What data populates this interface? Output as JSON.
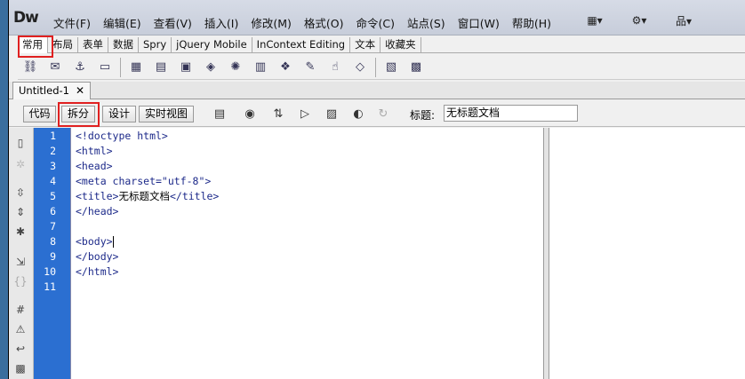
{
  "app": {
    "logo": "Dw"
  },
  "menu": [
    "文件(F)",
    "编辑(E)",
    "查看(V)",
    "插入(I)",
    "修改(M)",
    "格式(O)",
    "命令(C)",
    "站点(S)",
    "窗口(W)",
    "帮助(H)"
  ],
  "toolbar_right": [
    "▦▾",
    "⚙▾",
    "品▾"
  ],
  "insert_tabs": [
    "常用",
    "布局",
    "表单",
    "数据",
    "Spry",
    "jQuery Mobile",
    "InContext Editing",
    "文本",
    "收藏夹"
  ],
  "insert_icons": [
    "hyperlink-icon",
    "email-icon",
    "anchor-icon",
    "horizontal-rule-icon",
    "table-icon",
    "div-icon",
    "image-icon",
    "media-icon",
    "widget-icon",
    "date-icon",
    "server-include-icon",
    "comment-icon",
    "head-icon",
    "script-icon",
    "template-icon",
    "tag-chooser-icon"
  ],
  "document": {
    "tab_name": "Untitled-1",
    "close": "✕"
  },
  "view_bar": {
    "code_label": "代码",
    "split_label": "拆分",
    "design_label": "设计",
    "live_label": "实时视图",
    "title_label": "标题:",
    "title_value": "无标题文档"
  },
  "editor": {
    "line_numbers": [
      "1",
      "2",
      "3",
      "4",
      "5",
      "6",
      "7",
      "8",
      "9",
      "10",
      "11"
    ],
    "lines": [
      {
        "pre": "<!doctype html>",
        "text": "",
        "post": ""
      },
      {
        "pre": "<html>",
        "text": "",
        "post": ""
      },
      {
        "pre": "<head>",
        "text": "",
        "post": ""
      },
      {
        "pre": "<meta charset=\"utf-8\">",
        "text": "",
        "post": ""
      },
      {
        "pre": "<title>",
        "text": "无标题文档",
        "post": "</title>"
      },
      {
        "pre": "</head>",
        "text": "",
        "post": ""
      },
      {
        "pre": "",
        "text": "",
        "post": ""
      },
      {
        "pre": "<body>",
        "text": "",
        "post": ""
      },
      {
        "pre": "</body>",
        "text": "",
        "post": ""
      },
      {
        "pre": "</html>",
        "text": "",
        "post": ""
      },
      {
        "pre": "",
        "text": "",
        "post": ""
      }
    ]
  },
  "colors": {
    "gutter": "#2b6fd1",
    "highlight": "#e02020",
    "code": "#1d2a8a"
  }
}
